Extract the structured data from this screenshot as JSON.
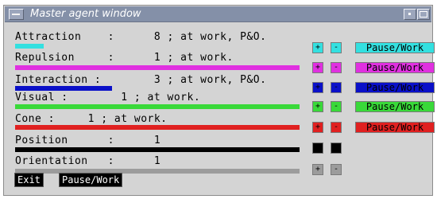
{
  "window": {
    "title": "Master agent window"
  },
  "rows": [
    {
      "label": "Attraction    :      8 ; at work, P&O.",
      "color": "#33e0e0",
      "level": 0.1
    },
    {
      "label": "Repulsion     :      1 ; at work.",
      "color": "#e030e0",
      "level": 1.0
    },
    {
      "label": "Interaction :        3 ; at work, P&O.",
      "color": "#0a10c8",
      "level": 0.34
    },
    {
      "label": "Visual :        1 ; at work.",
      "color": "#39d939",
      "level": 1.0
    },
    {
      "label": "Cone :     1 ; at work.",
      "color": "#e02020",
      "level": 1.0
    },
    {
      "label": "Position      :      1",
      "color": "#000000",
      "level": 1.0
    },
    {
      "label": "Orientation   :      1",
      "color": "#9c9c9c",
      "level": 1.0
    }
  ],
  "controls": [
    {
      "plus": "+",
      "minus": "-",
      "pause_label": "Pause/Work",
      "color": "#33e0e0"
    },
    {
      "plus": "+",
      "minus": "-",
      "pause_label": "Pause/Work",
      "color": "#e030e0"
    },
    {
      "plus": "+",
      "minus": "-",
      "pause_label": "Pause/Work",
      "color": "#0a10c8"
    },
    {
      "plus": "+",
      "minus": "-",
      "pause_label": "Pause/Work",
      "color": "#39d939"
    },
    {
      "plus": "+",
      "minus": "-",
      "pause_label": "Pause/Work",
      "color": "#e02020"
    },
    {
      "plus": "+",
      "minus": "-",
      "color": "#000000"
    },
    {
      "plus": "+",
      "minus": "-",
      "color": "#9c9c9c"
    }
  ],
  "bottom": {
    "exit_label": "Exit",
    "pause_label": "Pause/Work"
  }
}
